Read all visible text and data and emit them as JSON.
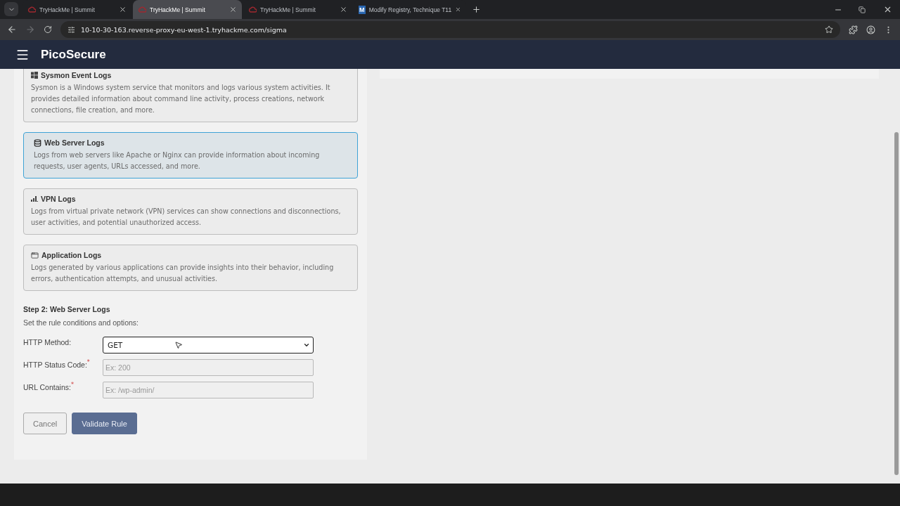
{
  "browser": {
    "tabs": [
      {
        "title": "TryHackMe | Summit",
        "selected": false,
        "kind": "thm"
      },
      {
        "title": "TryHackMe | Summit",
        "selected": true,
        "kind": "thm"
      },
      {
        "title": "TryHackMe | Summit",
        "selected": false,
        "kind": "thm"
      },
      {
        "title": "Modify Registry, Technique T11",
        "selected": false,
        "kind": "mitre",
        "logo": "M"
      }
    ],
    "url": "10-10-30-163.reverse-proxy-eu-west-1.tryhackme.com/sigma"
  },
  "app": {
    "title": "PicoSecure"
  },
  "log_sources": [
    {
      "kind": "windows",
      "title": "Sysmon Event Logs",
      "description": "Sysmon is a Windows system service that monitors and logs various system activities. It provides detailed information about command line activity, process creations, network connections, file creation, and more.",
      "selected": false
    },
    {
      "kind": "database",
      "title": "Web Server Logs",
      "description": "Logs from web servers like Apache or Nginx can provide information about incoming requests, user agents, URLs accessed, and more.",
      "selected": true
    },
    {
      "kind": "signal",
      "title": "VPN Logs",
      "description": "Logs from virtual private network (VPN) services can show connections and disconnections, user activities, and potential unauthorized access.",
      "selected": false
    },
    {
      "kind": "window",
      "title": "Application Logs",
      "description": "Logs generated by various applications can provide insights into their behavior, including errors, authentication attempts, and unusual activities.",
      "selected": false
    }
  ],
  "step": {
    "title": "Step 2: Web Server Logs",
    "subtitle": "Set the rule conditions and options:",
    "fields": [
      {
        "kind": "select",
        "label": "HTTP Method:",
        "value": "GET"
      },
      {
        "kind": "text",
        "label": "HTTP Status Code:",
        "marker": "*",
        "placeholder": "Ex: 200"
      },
      {
        "kind": "text",
        "label": "URL Contains:",
        "marker": "*",
        "placeholder": "Ex: /wp-admin/"
      }
    ],
    "buttons": [
      {
        "kind": "secondary",
        "label": "Cancel"
      },
      {
        "kind": "primary",
        "label": "Validate Rule"
      }
    ]
  }
}
